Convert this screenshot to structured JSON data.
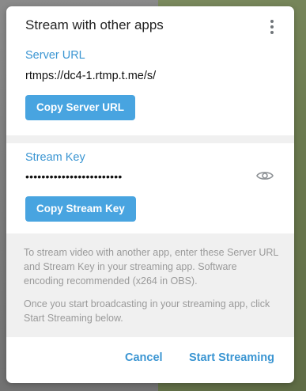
{
  "dialog": {
    "title": "Stream with other apps",
    "menu_icon": "more-vertical-icon"
  },
  "server": {
    "label": "Server URL",
    "value": "rtmps://dc4-1.rtmp.t.me/s/",
    "copy_button": "Copy Server URL"
  },
  "stream_key": {
    "label": "Stream Key",
    "masked_value": "••••••••••••••••••••••••",
    "reveal_icon": "eye-icon",
    "copy_button": "Copy Stream Key"
  },
  "info": {
    "paragraph_1": "To stream video with another app, enter these Server URL and Stream Key in your streaming app. Software encoding recommended (x264 in OBS).",
    "paragraph_2": "Once you start broadcasting in your streaming app, click Start Streaming below."
  },
  "footer": {
    "cancel": "Cancel",
    "start": "Start Streaming"
  },
  "colors": {
    "accent": "#3a95d2",
    "button": "#48a4e0",
    "muted_text": "#9a9a9a",
    "section_bg": "#f0f0f0"
  }
}
